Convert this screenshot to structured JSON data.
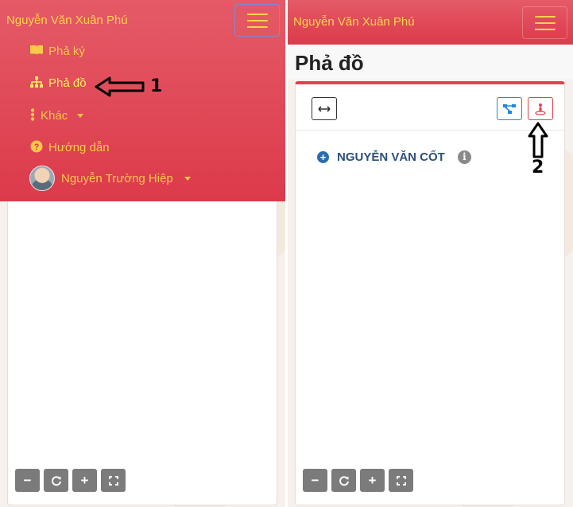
{
  "app": {
    "brand": "Nguyễn Văn Xuân Phú"
  },
  "left": {
    "menu": [
      {
        "label": "Phả ký",
        "icon": "book-icon"
      },
      {
        "label": "Phả đồ",
        "icon": "sitemap-icon",
        "active": true
      },
      {
        "label": "Khác",
        "icon": "ellipsis-vertical-icon",
        "dropdown": true
      },
      {
        "label": "Hướng dẫn",
        "icon": "question-circle-icon"
      },
      {
        "label": "Nguyễn Trường Hiệp",
        "icon": "avatar",
        "dropdown": true
      }
    ],
    "annotation": "1"
  },
  "right": {
    "page_title": "Phả đồ",
    "tree_root": "NGUYỄN VĂN CỐT",
    "annotation": "2"
  },
  "colors": {
    "navbar": "#dc3a4a",
    "brand_text": "#ffd54a",
    "tree_text": "#2b4f7c",
    "zoom_btn": "#7b7b7b"
  }
}
